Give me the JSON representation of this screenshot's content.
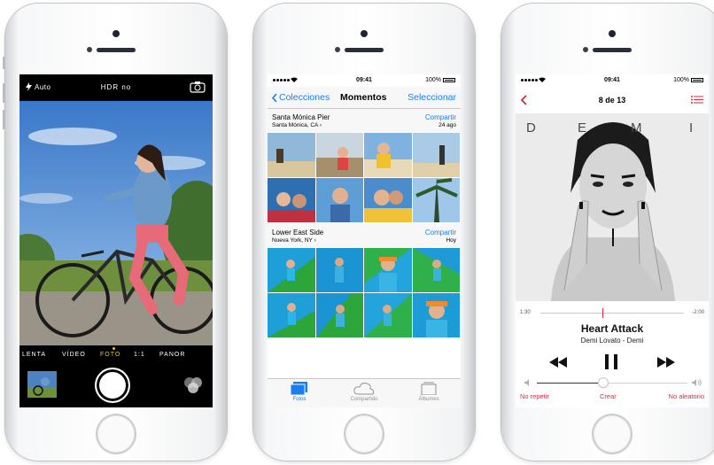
{
  "colors": {
    "ios_blue": "#1a7ef2",
    "music_red": "#e0263a",
    "camera_yellow": "#f5c518"
  },
  "camera": {
    "flash_label": "Auto",
    "hdr_label": "HDR no",
    "modes": [
      "LENTA",
      "VÍDEO",
      "FOTO",
      "1:1",
      "PANOR"
    ],
    "active_mode": "FOTO",
    "icons": [
      "flash-icon",
      "flip-camera-icon",
      "shutter-button",
      "filters-icon"
    ]
  },
  "photos": {
    "status": {
      "time": "09:41",
      "battery": "100%"
    },
    "nav": {
      "back_label": "Colecciones",
      "title": "Momentos",
      "select_label": "Seleccionar"
    },
    "sections": [
      {
        "place": "Santa Mónica Pier",
        "subtitle": "Santa Mónica, CA",
        "share_label": "Compartir",
        "date": "24 ago"
      },
      {
        "place": "Lower East Side",
        "subtitle": "Nueva York, NY",
        "share_label": "Compartir",
        "date": "Hoy"
      }
    ],
    "tabs": [
      {
        "label": "Fotos",
        "icon": "photos-tab-icon",
        "active": true
      },
      {
        "label": "Compartido",
        "icon": "cloud-icon",
        "active": false
      },
      {
        "label": "Álbumes",
        "icon": "albums-icon",
        "active": false
      }
    ]
  },
  "music": {
    "status": {
      "time": "09:41",
      "battery": "100%"
    },
    "track_count": "8 de 13",
    "album_letters": [
      "D",
      "E",
      "M",
      "I"
    ],
    "elapsed": "1:30",
    "remaining": "-2:00",
    "progress_fraction": 0.43,
    "song_title": "Heart Attack",
    "artist_album": "Demi Lovato - Demi",
    "volume_fraction": 0.44,
    "actions": {
      "repeat": "No repetir",
      "create": "Crear",
      "shuffle": "No aleatorio"
    }
  }
}
